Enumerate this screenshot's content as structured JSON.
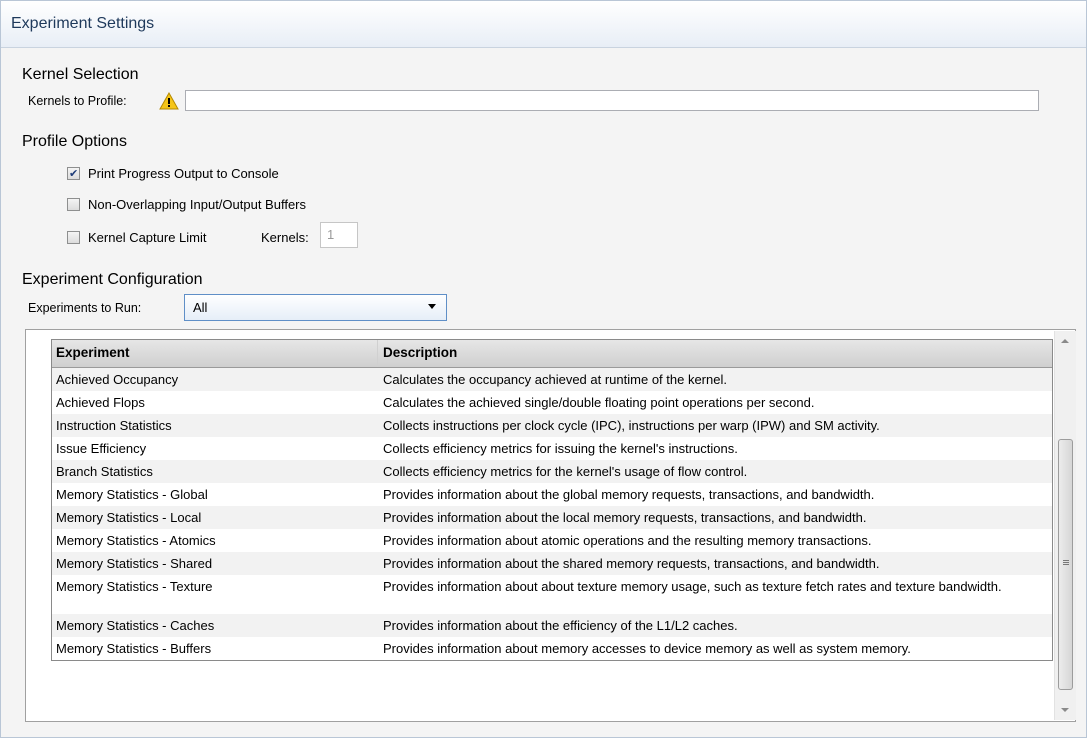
{
  "header": {
    "title": "Experiment Settings"
  },
  "kernel_selection": {
    "title": "Kernel Selection",
    "label": "Kernels to Profile:",
    "value": ""
  },
  "profile_options": {
    "title": "Profile Options",
    "print_progress": {
      "label": "Print Progress Output to Console",
      "checked": true
    },
    "non_overlapping": {
      "label": "Non-Overlapping Input/Output Buffers",
      "checked": false
    },
    "capture_limit": {
      "label": "Kernel Capture Limit",
      "checked": false
    },
    "kernels_label": "Kernels:",
    "kernels_value": "1"
  },
  "experiment_config": {
    "title": "Experiment Configuration",
    "run_label": "Experiments to Run:",
    "run_value": "All"
  },
  "grid": {
    "headers": [
      "Experiment",
      "Description"
    ],
    "rows": [
      [
        "Achieved Occupancy",
        "Calculates the occupancy achieved at runtime of the kernel."
      ],
      [
        "Achieved Flops",
        "Calculates the achieved single/double floating point operations per second."
      ],
      [
        "Instruction Statistics",
        "Collects instructions per clock cycle (IPC), instructions per warp (IPW) and SM activity."
      ],
      [
        "Issue Efficiency",
        "Collects efficiency metrics for issuing the kernel's instructions."
      ],
      [
        "Branch Statistics",
        "Collects efficiency metrics for the kernel's usage of flow control."
      ],
      [
        "Memory Statistics - Global",
        "Provides information about the global memory requests, transactions, and bandwidth."
      ],
      [
        "Memory Statistics - Local",
        "Provides information about the local memory requests, transactions, and bandwidth."
      ],
      [
        "Memory Statistics - Atomics",
        "Provides information about atomic operations and the resulting memory transactions."
      ],
      [
        "Memory Statistics - Shared",
        "Provides information about the shared memory requests, transactions, and bandwidth."
      ],
      [
        "Memory Statistics - Texture",
        "Provides information about about texture memory usage, such as texture fetch rates and texture bandwidth."
      ],
      [
        "Memory Statistics - Caches",
        "Provides information about the efficiency of the L1/L2 caches."
      ],
      [
        "Memory Statistics - Buffers",
        "Provides information about memory accesses to device memory as well as system memory."
      ]
    ]
  },
  "icons": {
    "warning": "warning-icon",
    "dropdown": "chevron-down-icon"
  }
}
